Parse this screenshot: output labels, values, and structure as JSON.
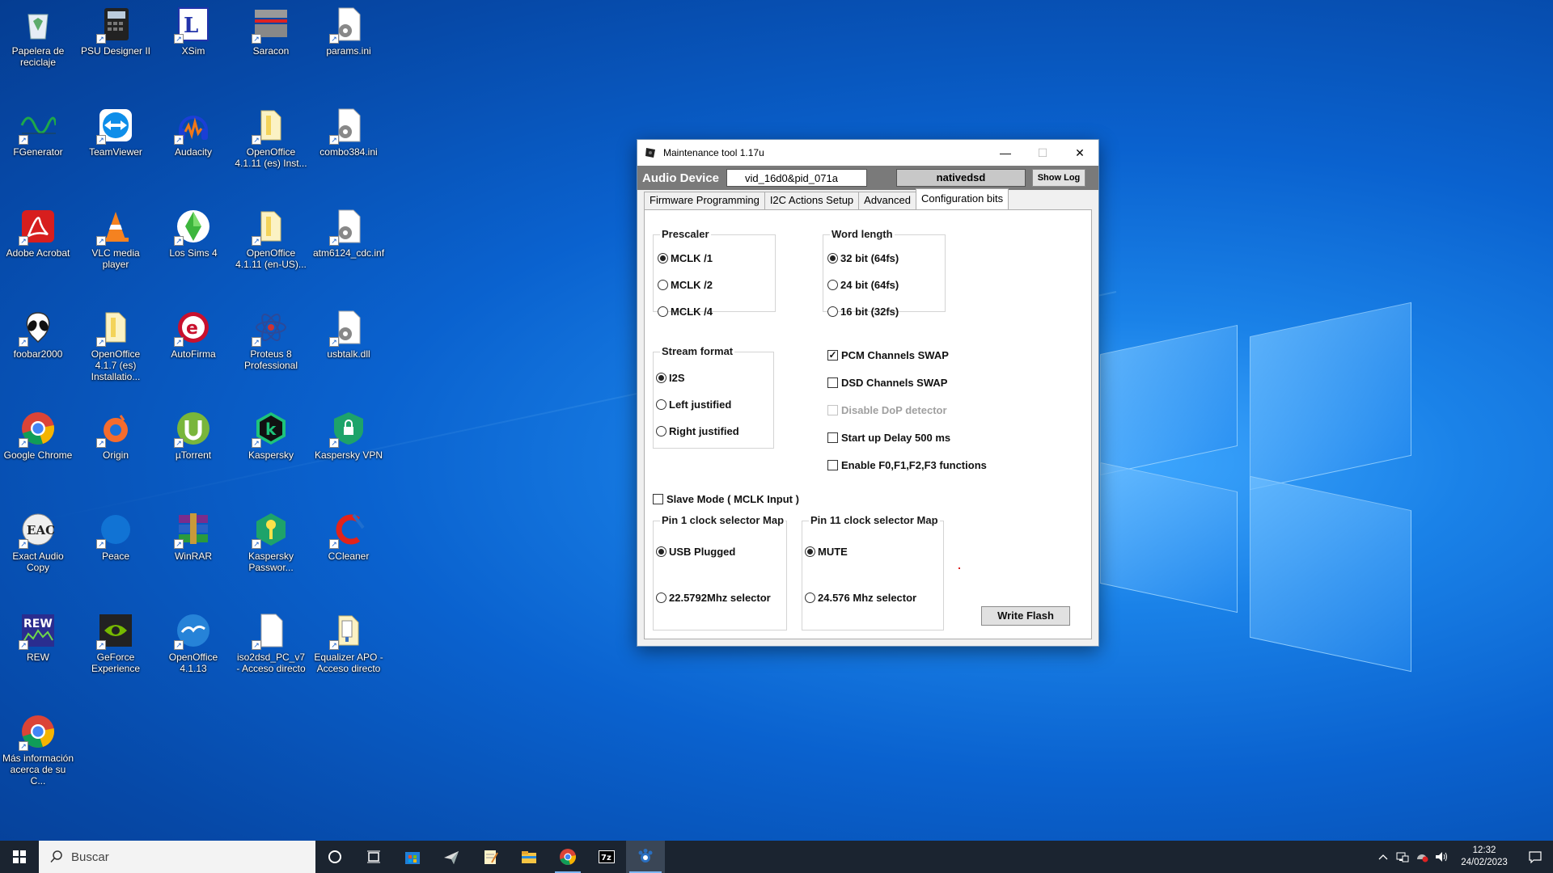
{
  "desktop": {
    "icons": [
      {
        "label": "Papelera de reciclaje",
        "icon": "recycle-bin-icon"
      },
      {
        "label": "PSU Designer II",
        "icon": "calculator-icon"
      },
      {
        "label": "XSim",
        "icon": "xsim-icon"
      },
      {
        "label": "Saracon",
        "icon": "saracon-icon"
      },
      {
        "label": "params.ini",
        "icon": "settings-file-icon"
      },
      {
        "label": "FGenerator",
        "icon": "waveform-icon"
      },
      {
        "label": "TeamViewer",
        "icon": "teamviewer-icon"
      },
      {
        "label": "Audacity",
        "icon": "headphones-icon"
      },
      {
        "label": "OpenOffice 4.1.11 (es) Inst...",
        "icon": "folder-icon"
      },
      {
        "label": "combo384.ini",
        "icon": "settings-file-icon"
      },
      {
        "label": "Adobe Acrobat",
        "icon": "acrobat-icon"
      },
      {
        "label": "VLC media player",
        "icon": "vlc-cone-icon"
      },
      {
        "label": "Los Sims 4",
        "icon": "sims-plumbob-icon"
      },
      {
        "label": "OpenOffice 4.1.11 (en-US)...",
        "icon": "folder-icon"
      },
      {
        "label": "atm6124_cdc.inf",
        "icon": "settings-file-icon"
      },
      {
        "label": "foobar2000",
        "icon": "alien-icon"
      },
      {
        "label": "OpenOffice 4.1.7 (es) Installatio...",
        "icon": "folder-icon"
      },
      {
        "label": "AutoFirma",
        "icon": "autofirma-icon"
      },
      {
        "label": "Proteus 8 Professional",
        "icon": "atom-icon"
      },
      {
        "label": "usbtalk.dll",
        "icon": "settings-file-icon"
      },
      {
        "label": "Google Chrome",
        "icon": "chrome-icon"
      },
      {
        "label": "Origin",
        "icon": "origin-icon"
      },
      {
        "label": "µTorrent",
        "icon": "utorrent-icon"
      },
      {
        "label": "Kaspersky",
        "icon": "kaspersky-icon"
      },
      {
        "label": "Kaspersky VPN",
        "icon": "shield-lock-icon"
      },
      {
        "label": "Exact Audio Copy",
        "icon": "eac-icon"
      },
      {
        "label": "Peace",
        "icon": "peace-icon"
      },
      {
        "label": "WinRAR",
        "icon": "winrar-icon"
      },
      {
        "label": "Kaspersky Passwor...",
        "icon": "key-shield-icon"
      },
      {
        "label": "CCleaner",
        "icon": "ccleaner-icon"
      },
      {
        "label": "REW",
        "icon": "rew-icon"
      },
      {
        "label": "GeForce Experience",
        "icon": "nvidia-icon"
      },
      {
        "label": "OpenOffice 4.1.13",
        "icon": "openoffice-gull-icon"
      },
      {
        "label": "iso2dsd_PC_v7 - Acceso directo",
        "icon": "blank-file-icon"
      },
      {
        "label": "Equalizer APO - Acceso directo",
        "icon": "folder-doc-icon"
      },
      {
        "label": "Más información acerca de su C...",
        "icon": "chrome-icon"
      }
    ]
  },
  "window": {
    "title": "Maintenance tool 1.17u",
    "controls": {
      "minimize": "—",
      "maximize": "☐",
      "close": "✕"
    },
    "device_label": "Audio Device",
    "device_value": "vid_16d0&pid_071a",
    "mode_value": "nativedsd",
    "show_log": "Show Log",
    "tabs": [
      "Firmware Programming",
      "I2C Actions Setup",
      "Advanced",
      "Configuration bits"
    ],
    "active_tab": "Configuration bits",
    "prescaler": {
      "title": "Prescaler",
      "options": [
        "MCLK /1",
        "MCLK /2",
        "MCLK /4"
      ],
      "selected": "MCLK /1"
    },
    "word_length": {
      "title": "Word length",
      "options": [
        "32 bit (64fs)",
        "24 bit (64fs)",
        "16 bit (32fs)"
      ],
      "selected": "32 bit (64fs)"
    },
    "stream_format": {
      "title": "Stream format",
      "options": [
        "I2S",
        "Left justified",
        "Right justified"
      ],
      "selected": "I2S"
    },
    "checkboxes": [
      {
        "label": "PCM Channels SWAP",
        "checked": true,
        "enabled": true
      },
      {
        "label": "DSD Channels SWAP",
        "checked": false,
        "enabled": true
      },
      {
        "label": "Disable DoP detector",
        "checked": false,
        "enabled": false
      },
      {
        "label": "Start up Delay 500 ms",
        "checked": false,
        "enabled": true
      },
      {
        "label": "Enable F0,F1,F2,F3 functions",
        "checked": false,
        "enabled": true
      }
    ],
    "slave_mode": {
      "label": "Slave Mode ( MCLK Input )",
      "checked": false
    },
    "pin1": {
      "title": "Pin 1 clock selector Map",
      "options": [
        "USB Plugged",
        "22.5792Mhz selector"
      ],
      "selected": "USB Plugged"
    },
    "pin11": {
      "title": "Pin 11 clock selector Map",
      "options": [
        "MUTE",
        "24.576 Mhz selector"
      ],
      "selected": "MUTE"
    },
    "write_flash": "Write Flash"
  },
  "taskbar": {
    "search_placeholder": "Buscar",
    "apps": [
      "cortana-icon",
      "task-view-icon",
      "store-icon",
      "paper-plane-icon",
      "notepad-icon",
      "file-explorer-icon",
      "chrome-icon",
      "7zip-icon",
      "maintenance-tool-icon"
    ],
    "active_app": "maintenance-tool-icon",
    "tray": {
      "time": "12:32",
      "date": "24/02/2023"
    }
  }
}
